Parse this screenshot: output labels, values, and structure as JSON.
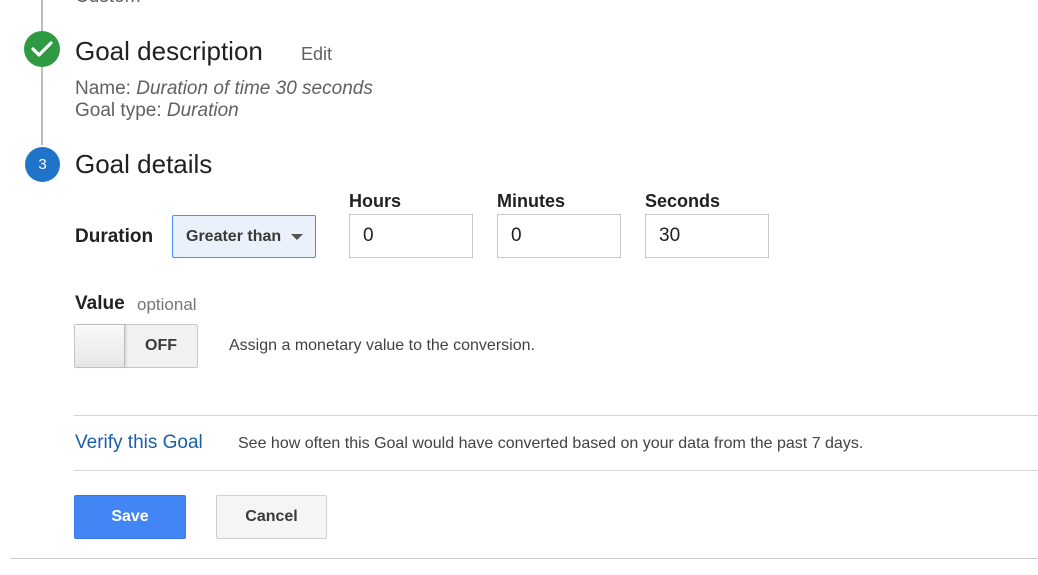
{
  "previous_step": {
    "value_text": "Custom"
  },
  "goal_description": {
    "title": "Goal description",
    "edit_label": "Edit",
    "name_label": "Name: ",
    "name_value": "Duration of time 30 seconds",
    "type_label": "Goal type: ",
    "type_value": "Duration",
    "status": "complete",
    "status_color": "#2e9a41"
  },
  "goal_details": {
    "step_number": "3",
    "step_color": "#1f73c8",
    "title": "Goal details",
    "duration": {
      "label": "Duration",
      "condition_selected": "Greater than",
      "hours_label": "Hours",
      "hours_value": "0",
      "minutes_label": "Minutes",
      "minutes_value": "0",
      "seconds_label": "Seconds",
      "seconds_value": "30"
    },
    "value": {
      "label": "Value",
      "optional_label": "optional",
      "toggle_state": "OFF",
      "description": "Assign a monetary value to the conversion."
    },
    "verify": {
      "link_label": "Verify this Goal",
      "description": "See how often this Goal would have converted based on your data from the past 7 days."
    }
  },
  "actions": {
    "save_label": "Save",
    "cancel_label": "Cancel",
    "save_color": "#4285f4"
  }
}
